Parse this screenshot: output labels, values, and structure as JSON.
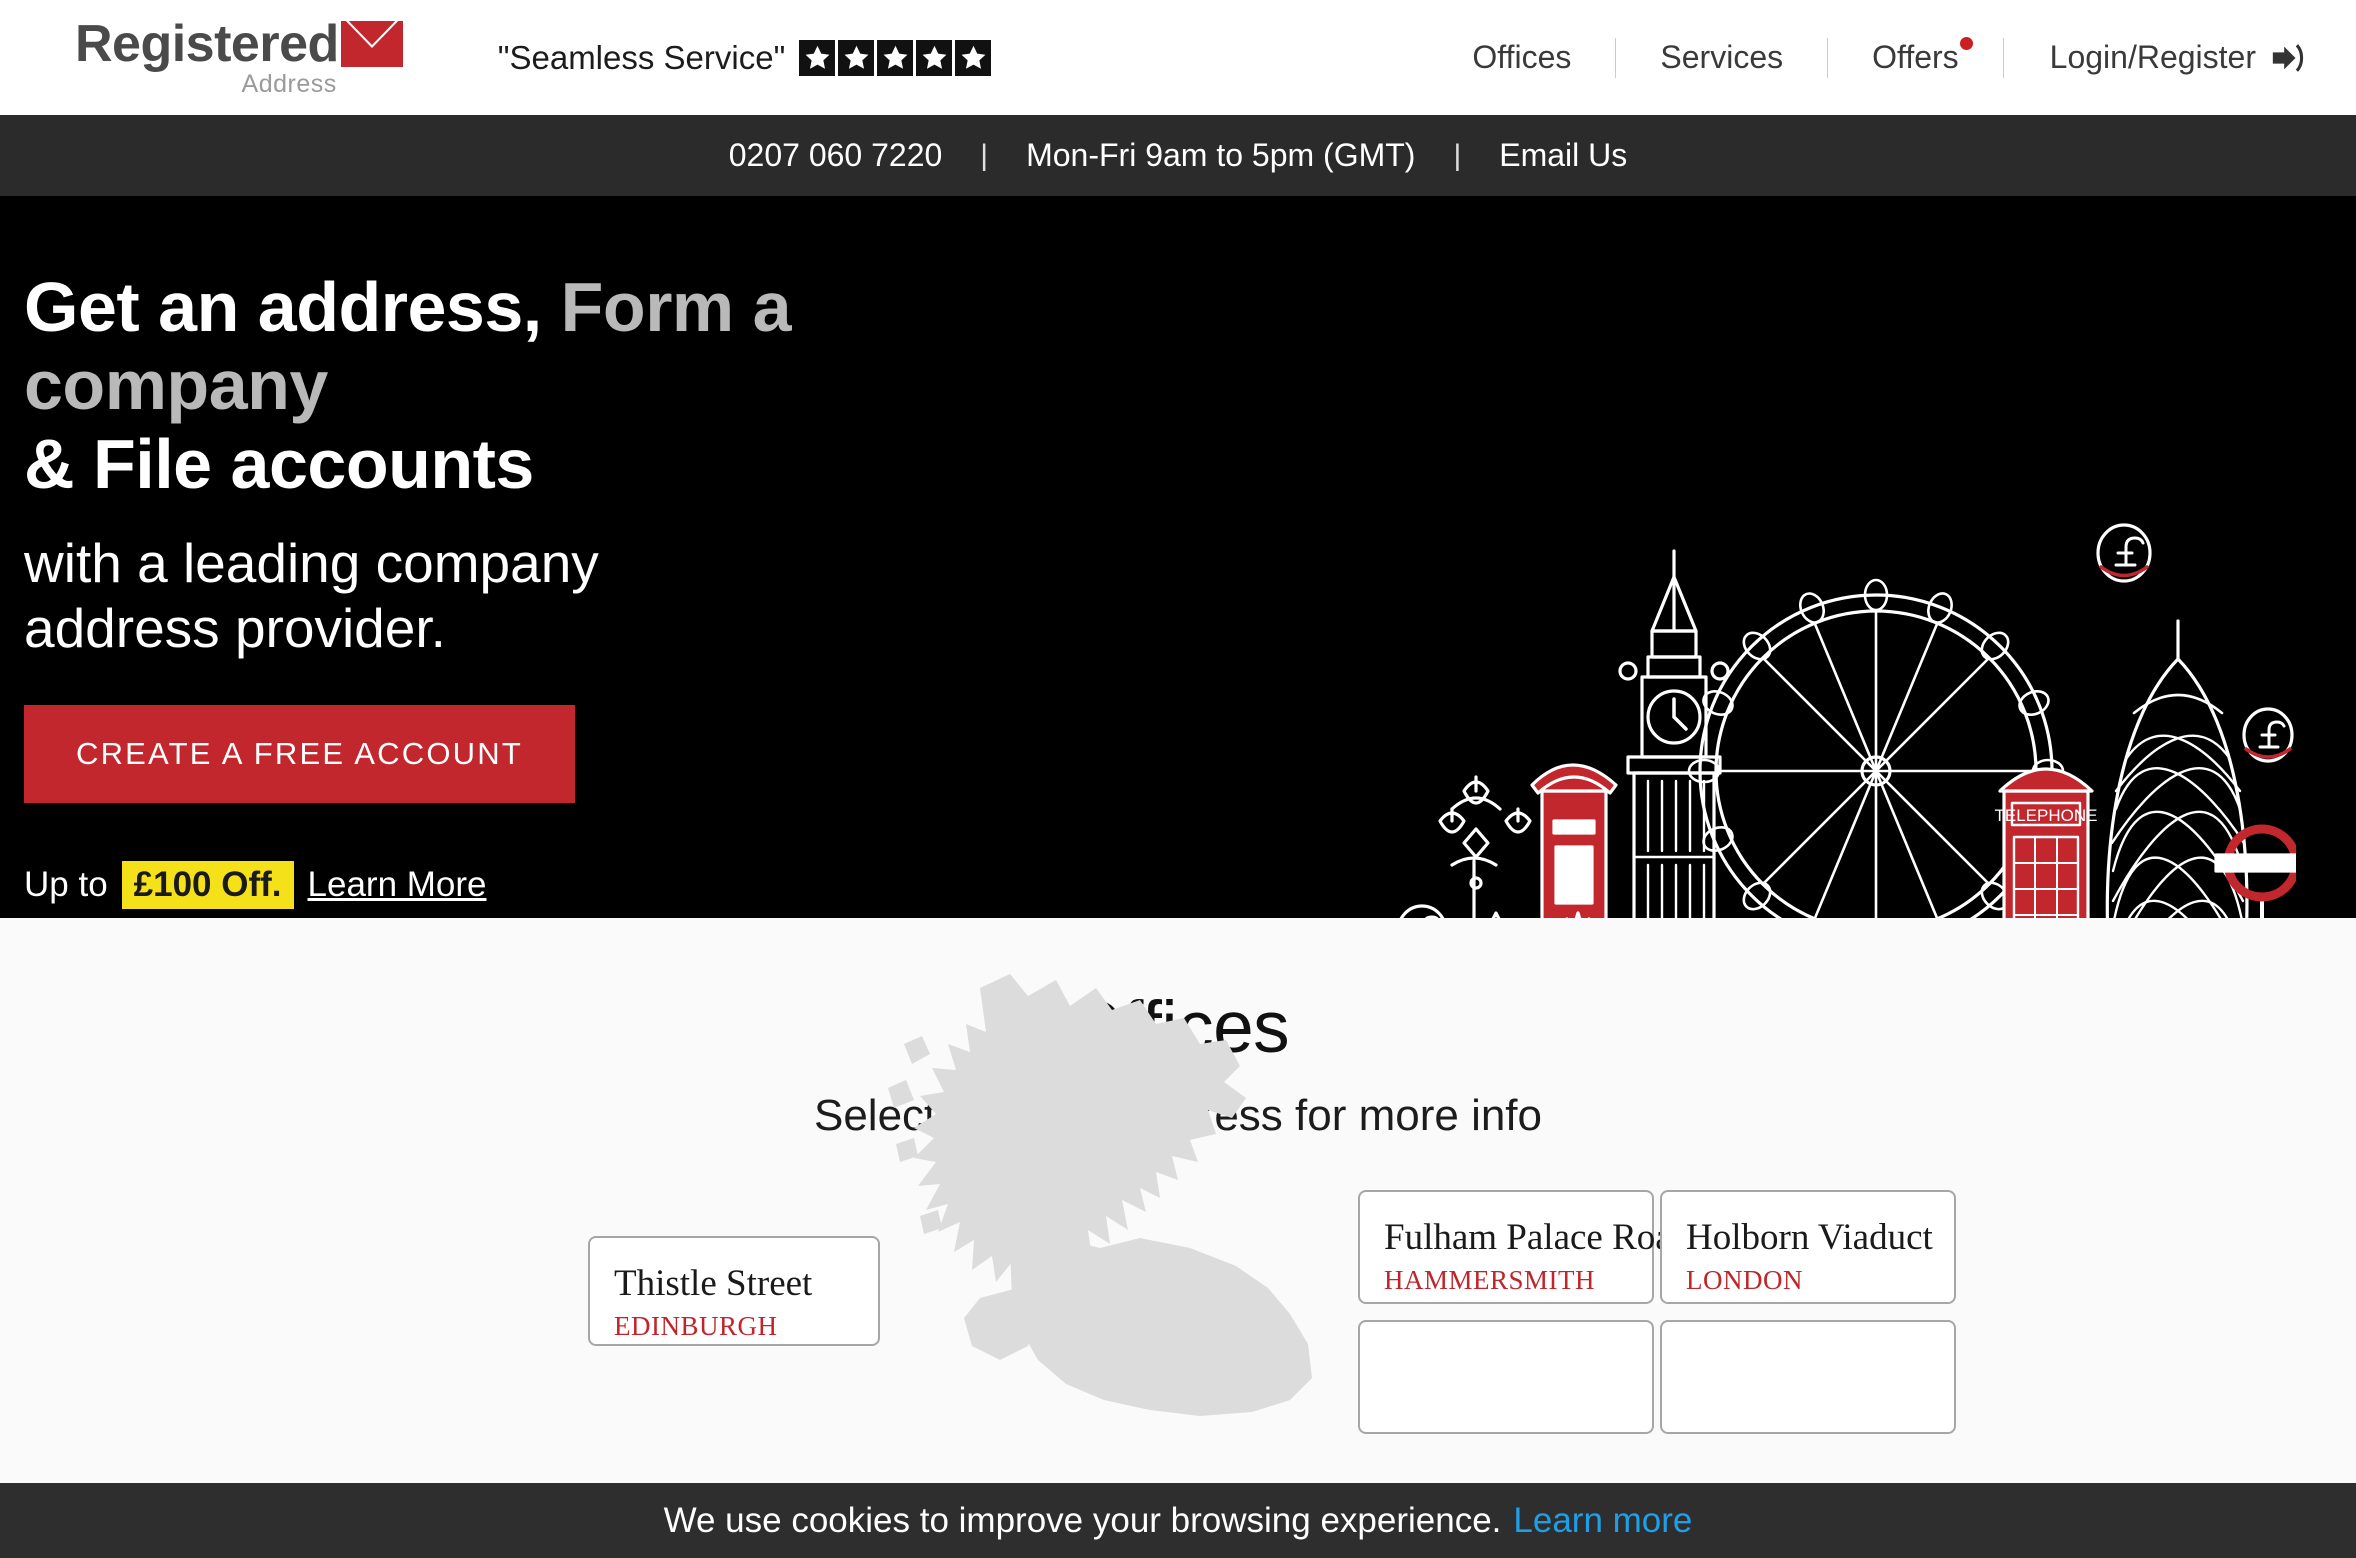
{
  "header": {
    "logo": {
      "main": "Registered",
      "sub": "Address",
      "envelope_color": "#c1272d",
      "icon": "envelope-icon"
    },
    "tagline": {
      "text": "\"Seamless Service\"",
      "stars": 5,
      "star_icon": "star-icon"
    },
    "nav": [
      {
        "label": "Offices",
        "badge": false
      },
      {
        "label": "Services",
        "badge": false
      },
      {
        "label": "Offers",
        "badge": true
      }
    ],
    "login": {
      "label": "Login/Register",
      "icon": "sign-in-icon"
    },
    "separator": "|"
  },
  "info_bar": {
    "phone": "0207 060 7220",
    "hours": "Mon-Fri  9am to 5pm (GMT)",
    "email": "Email Us",
    "separator": "|"
  },
  "hero": {
    "headline_part1": "Get an address,",
    "headline_part2": "Form a company",
    "headline_part3": "& File accounts",
    "subheadline_line1": "with a leading company",
    "subheadline_line2": "address provider.",
    "cta_label": "CREATE A FREE ACCOUNT",
    "cta_color": "#c1272d",
    "promo_prefix": "Up to",
    "promo_badge": "£100 Off.",
    "promo_badge_color": "#f5e119",
    "promo_link": "Learn More",
    "illustration": "london-skyline-illustration"
  },
  "offices": {
    "title": "Offices",
    "subtitle": "Select an office address for more info",
    "map": "uk-map-silhouette",
    "cards": [
      {
        "street": "Thistle Street",
        "city": "EDINBURGH"
      },
      {
        "street": "Fulham Palace Road",
        "city": "HAMMERSMITH"
      },
      {
        "street": "Holborn Viaduct",
        "city": "LONDON"
      }
    ],
    "city_color": "#c0252b"
  },
  "cookie_banner": {
    "text": "We use cookies to improve your browsing experience.",
    "link": "Learn more",
    "link_color": "#1f9fe8"
  }
}
